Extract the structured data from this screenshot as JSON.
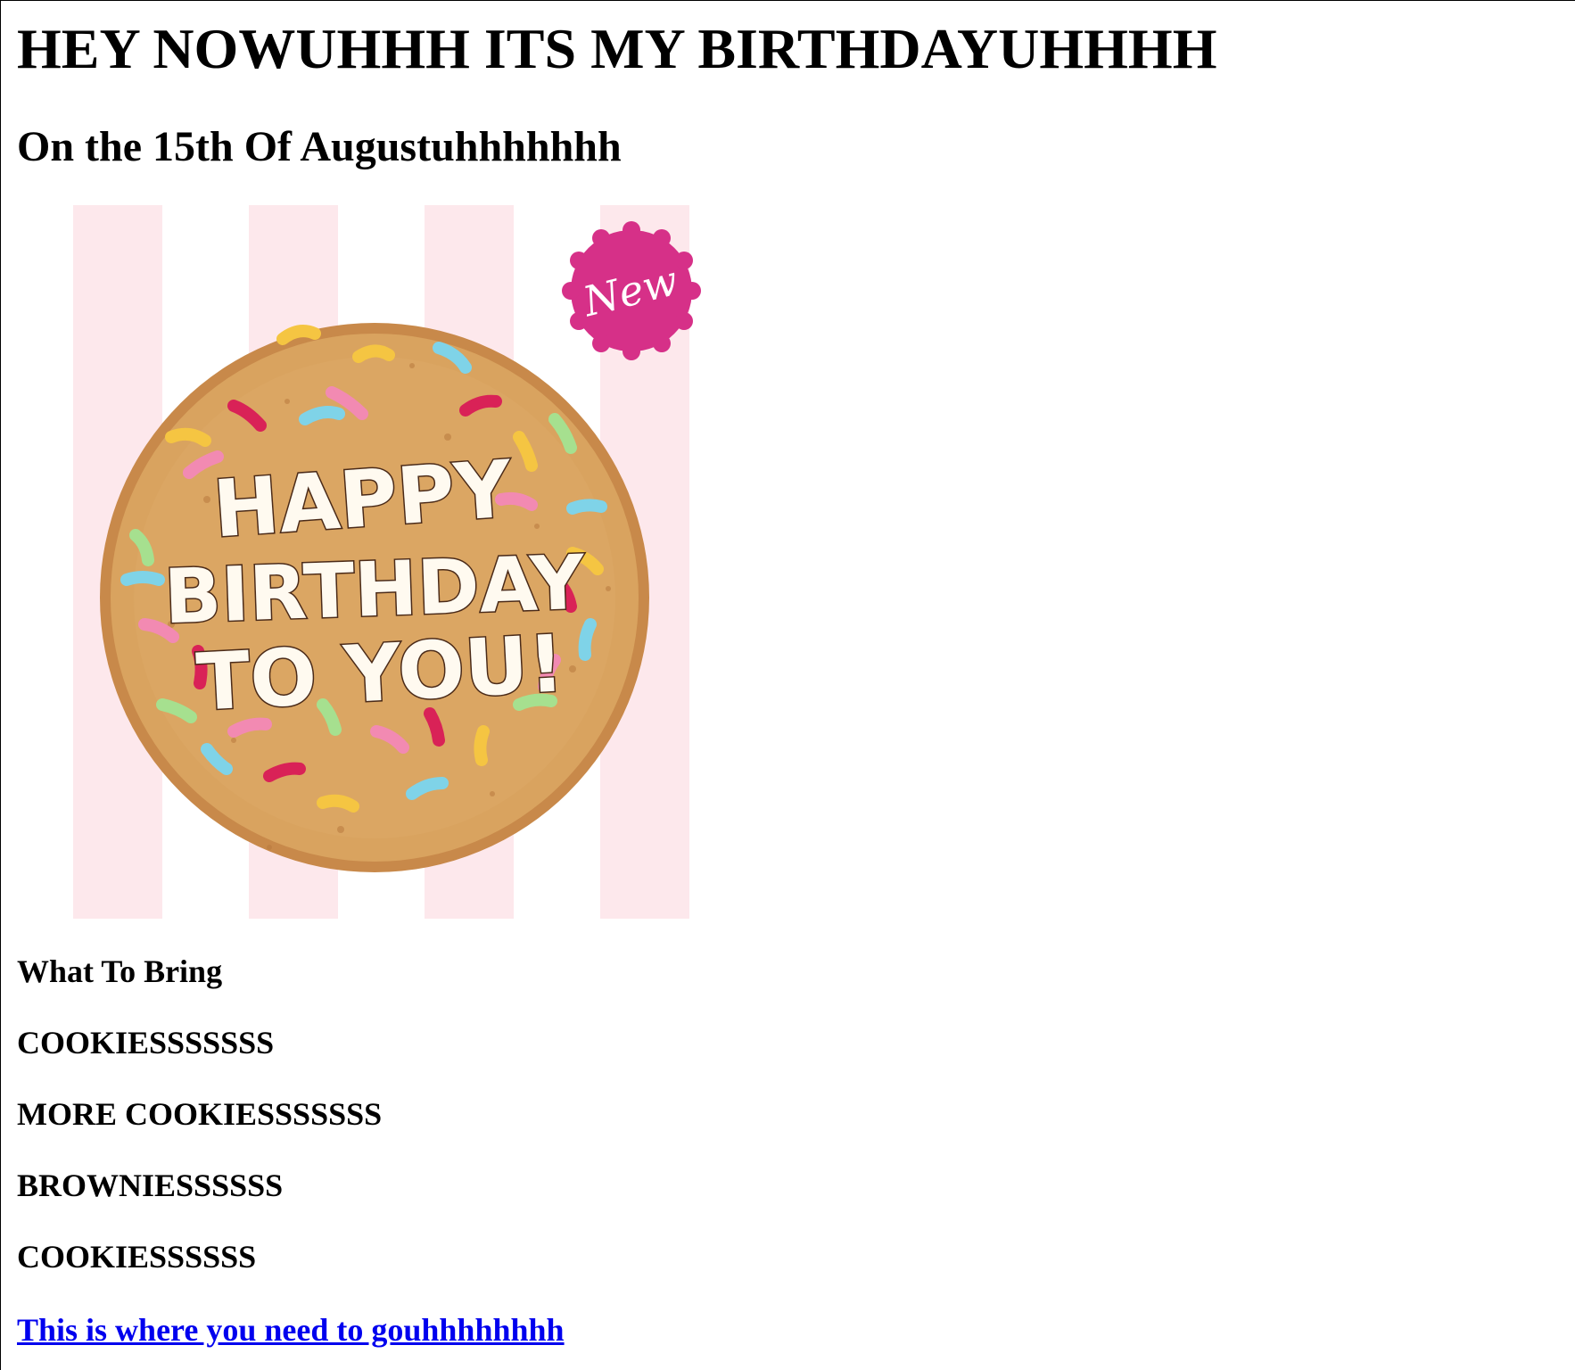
{
  "heading": "HEY NOWUHHH ITS MY BIRTHDAYUHHHH",
  "subheading": "On the 15th Of Augustuhhhhhhh",
  "image": {
    "cookie_text_lines": [
      "HAPPY",
      "BIRTHDAY",
      "TO YOU!"
    ],
    "badge_text": "New",
    "colors": {
      "stripe": "#fde8ec",
      "cookie": "#d9a35f",
      "badge": "#d63088",
      "icing": "#fffaf0"
    }
  },
  "bring": {
    "title": "What To Bring",
    "items": [
      "COOKIESSSSSSS",
      "MORE COOKIESSSSSSS",
      "BROWNIESSSSSS",
      "COOKIESSSSSS"
    ]
  },
  "link": {
    "text": "This is where you need to gouhhhhhhhh",
    "color": "#0000ee"
  }
}
